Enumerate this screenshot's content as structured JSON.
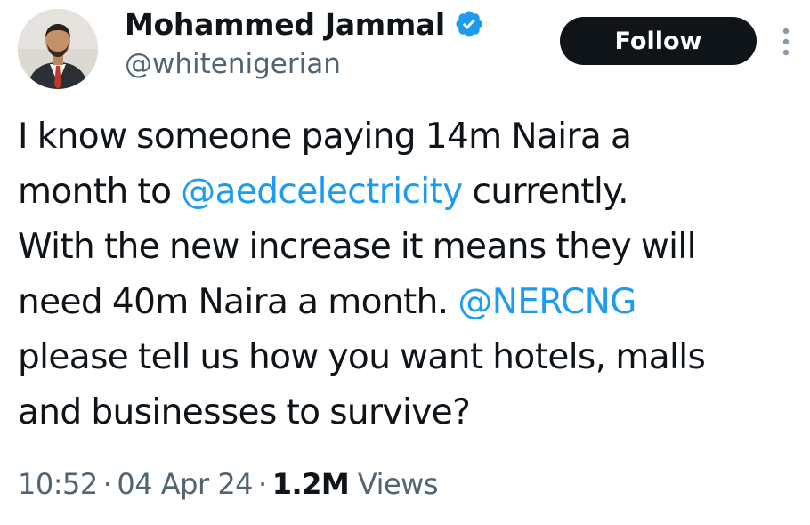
{
  "author": {
    "display_name": "Mohammed Jammal",
    "handle": "@whitenigerian",
    "verified": true,
    "avatar_icon": "profile-photo"
  },
  "actions": {
    "follow_label": "Follow",
    "more_icon": "vertical-ellipsis-icon"
  },
  "tweet": {
    "lines": [
      [
        {
          "text": "I know someone paying 14m Naira a"
        }
      ],
      [
        {
          "text": "month to "
        },
        {
          "text": "@aedcelectricity",
          "mention": true
        },
        {
          "text": " currently."
        }
      ],
      [
        {
          "text": "With the new increase it means they will"
        }
      ],
      [
        {
          "text": "need 40m Naira a month. "
        },
        {
          "text": "@NERCNG",
          "mention": true
        }
      ],
      [
        {
          "text": "please tell us how you want hotels, malls"
        }
      ],
      [
        {
          "text": "and businesses to survive?"
        }
      ]
    ]
  },
  "meta": {
    "time": "10:52",
    "separator": "·",
    "date": "04 Apr 24",
    "views_count": "1.2M",
    "views_label": "Views"
  },
  "colors": {
    "mention": "#1d9bf0",
    "verified_badge": "#1d9bf0",
    "secondary_text": "#536471",
    "primary_text": "#0f1419",
    "follow_button_bg": "#0f1419"
  }
}
